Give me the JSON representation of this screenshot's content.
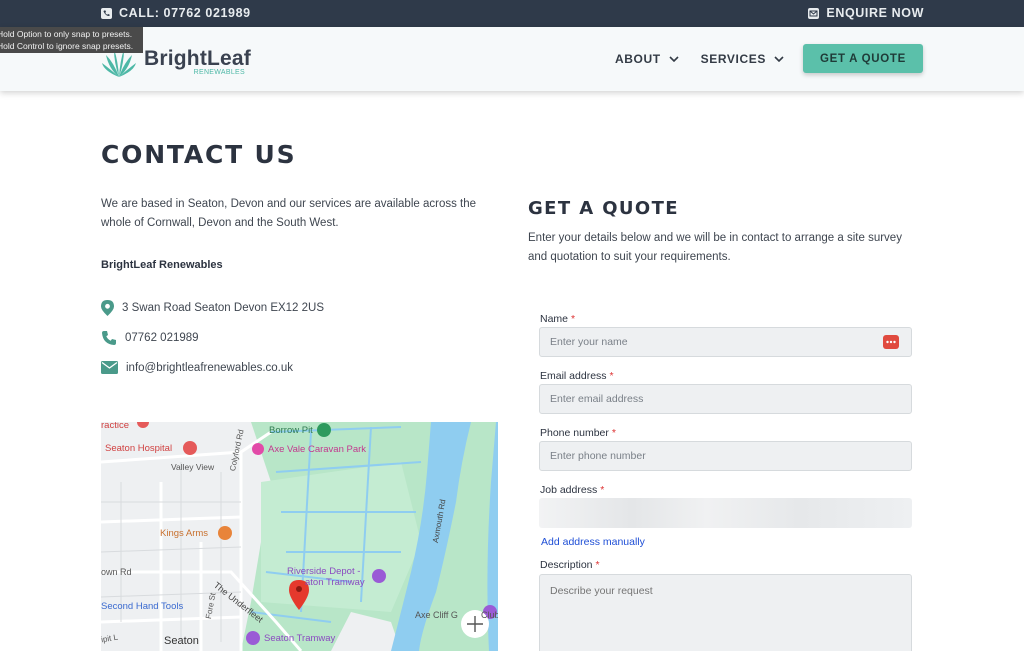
{
  "topbar": {
    "call": "CALL: 07762 021989",
    "enquire": "ENQUIRE NOW"
  },
  "tooltip": {
    "line1": "Hold Option to only snap to presets.",
    "line2": "Hold Control to ignore snap presets."
  },
  "header": {
    "logo_name": "BrightLeaf",
    "logo_sub": "RENEWABLES",
    "nav": [
      {
        "label": "ABOUT"
      },
      {
        "label": "SERVICES"
      }
    ],
    "quote_button": "GET A QUOTE"
  },
  "contact": {
    "title": "CONTACT US",
    "intro": "We are based in Seaton, Devon and our services are available across the whole of Cornwall, Devon and the South West.",
    "company": "BrightLeaf Renewables",
    "address": "3 Swan Road Seaton Devon EX12 2US",
    "phone": "07762 021989",
    "email": "info@brightleafrenewables.co.uk"
  },
  "map": {
    "labels": {
      "practice": "ractice",
      "hospital": "Seaton Hospital",
      "valley": "Valley View",
      "borrow": "Borrow Pit",
      "caravan": "Axe Vale Caravan Park",
      "colyford": "Colyford Rd",
      "kings": "Kings Arms",
      "town": "own Rd",
      "riverside1": "Riverside Depot -",
      "riverside2": "aton Tramway",
      "underfleet": "The Underfleet",
      "fore": "Fore St",
      "secondhand": "Second Hand Tools",
      "axemouth": "Axmouth Rd",
      "axecliff": "Axe Cliff G",
      "club": "Club",
      "tramway": "Seaton Tramway",
      "seaton": "Seaton",
      "ipit": "ipit L"
    }
  },
  "quote": {
    "title": "GET A QUOTE",
    "intro": "Enter your details below and we will be in contact to arrange a site survey and quotation to suit your requirements.",
    "name_label": "Name",
    "name_placeholder": "Enter your name",
    "email_label": "Email address",
    "email_placeholder": "Enter email address",
    "phone_label": "Phone number",
    "phone_placeholder": "Enter phone number",
    "job_label": "Job address",
    "manual_link": "Add address manually",
    "desc_label": "Description",
    "desc_placeholder": "Describe your request",
    "required_mark": "*"
  },
  "colors": {
    "topbar": "#2f3a4a",
    "accent": "#5bc0aa",
    "link": "#1f4fd6",
    "required": "#dd3333"
  }
}
